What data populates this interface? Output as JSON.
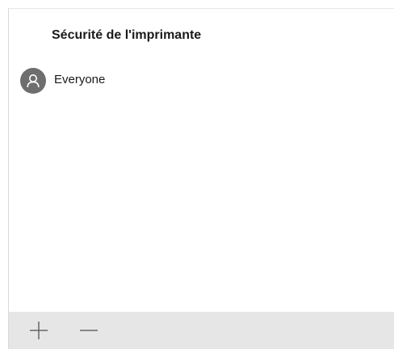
{
  "panel": {
    "title": "Sécurité de l'imprimante"
  },
  "users": [
    {
      "name": "Everyone",
      "icon": "person-icon"
    }
  ],
  "toolbar": {
    "add_icon": "plus-icon",
    "remove_icon": "minus-icon"
  },
  "colors": {
    "avatar_bg": "#6e6e6e",
    "toolbar_bg": "#e6e6e6",
    "icon_stroke": "#666666"
  }
}
